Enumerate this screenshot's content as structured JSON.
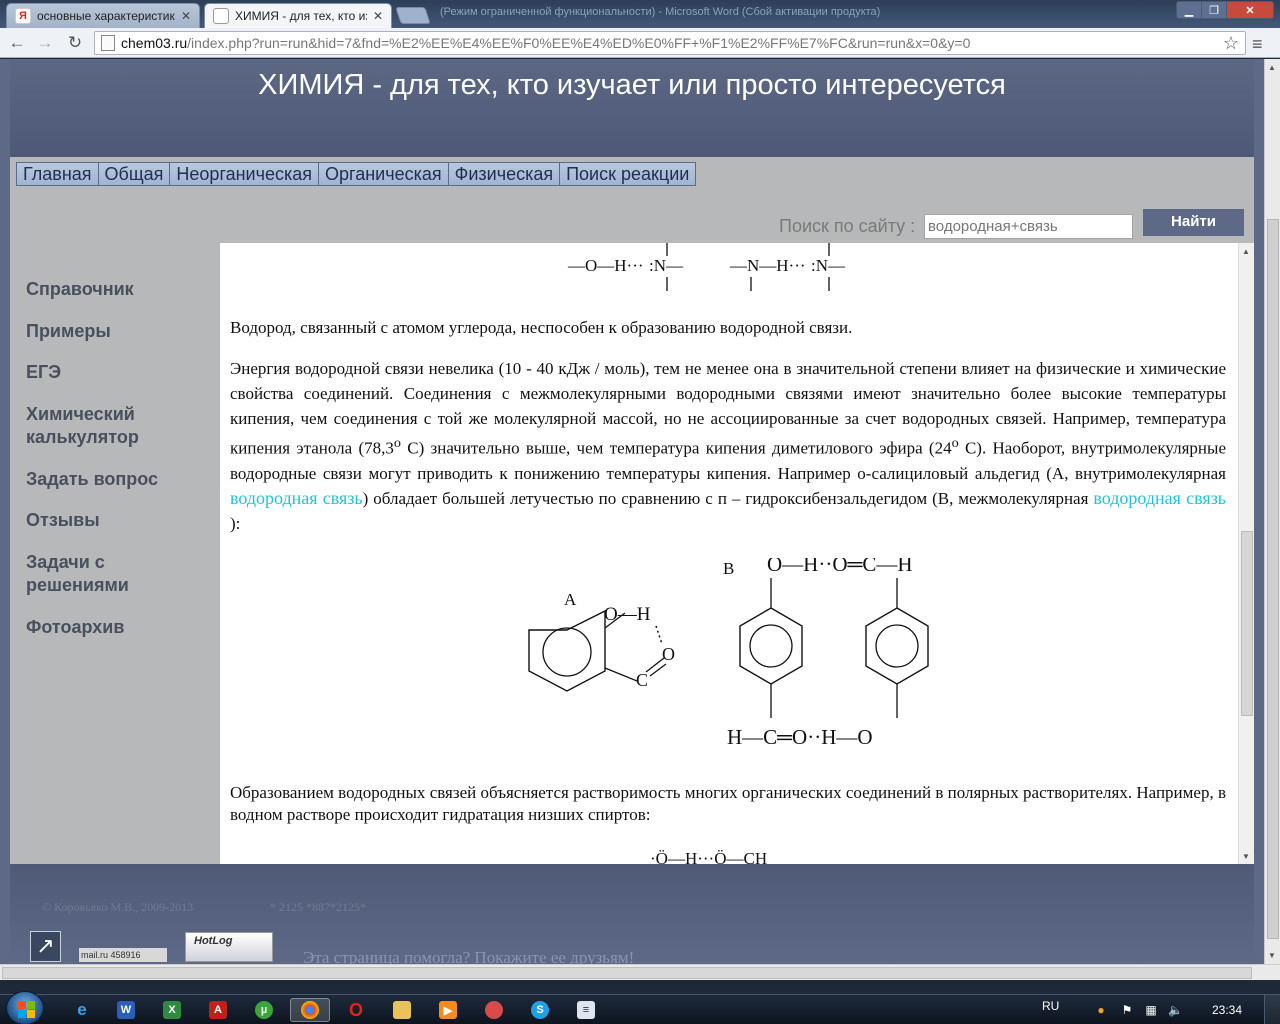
{
  "browser": {
    "tabs": [
      {
        "title": "основные характеристики",
        "favicon": "yandex-icon",
        "active": false
      },
      {
        "title": "ХИМИЯ - для тех, кто изу",
        "favicon": "page-icon",
        "active": true
      }
    ],
    "background_window_title": "(Режим ограниченной функциональности) - Microsoft Word (Сбой активации продукта)",
    "url_host": "chem03.ru",
    "url_rest": "/index.php?run=run&hid=7&fnd=%E2%EE%E4%EE%F0%EE%E4%ED%E0%FF+%F1%E2%FF%E7%FC&run=run&x=0&y=0"
  },
  "site": {
    "title": "ХИМИЯ - для тех, кто изучает или просто интересуется",
    "nav": [
      "Главная",
      "Общая",
      "Неорганическая",
      "Органическая",
      "Физическая",
      "Поиск реакции"
    ],
    "search": {
      "label": "Поиск по сайту :",
      "value": "водородная+связь",
      "button": "Найти"
    },
    "sidebar": [
      "Справочник",
      "Примеры",
      "ЕГЭ",
      "Химический\nкалькулятор",
      "Задать вопрос",
      "Отзывы",
      "Задачи с\nрешениями",
      "Фотоархив"
    ]
  },
  "content": {
    "para1": "Водород, связанный с атомом углерода, неспособен к образованию водородной связи.",
    "para2_a": "Энергия водородной связи невелика (10 - 40 кДж / моль), тем не менее она в значительной степени влияет на физические и химические свойства соединений. Соединения с межмолекулярными водородными связями имеют значительно более высокие температуры кипения, чем соединения с той же молекулярной массой, но не ассоциированные за счет водородных связей. Например, температура кипения этанола (78,3",
    "para2_sup1": "o",
    "para2_b": " С) значительно выше, чем температура кипения диметилового эфира (24",
    "para2_sup2": "o",
    "para2_c": " С). Наоборот, внутримолекулярные водородные связи могут приводить к понижению температуры кипения. Например о-салициловый альдегид (А, внутримолекулярная ",
    "para2_kw1": "водородная связь",
    "para2_d": ") обладает большей летучестью по сравнению с п – гидроксибензальдегидом (В, межмолекулярная ",
    "para2_kw2": "водородная связь",
    "para2_e": " ):",
    "para3": "Образованием водородных связей объясняется растворимость многих органических соединений в полярных растворителях. Например, в водном растворе происходит гидратация низших спиртов:",
    "top_formula": {
      "left": [
        "—O—H···",
        ":N—"
      ],
      "right": [
        "—N—H···",
        ":N—"
      ]
    },
    "figure": {
      "label_a": "A",
      "label_b": "B",
      "a_oh": "O—H",
      "a_o": "O",
      "a_c": "C",
      "b_top": "O—H··O═C—H",
      "b_bottom": "H—C═O··H—O"
    },
    "bottom_formula": "·Ö—H···Ö—CH"
  },
  "footer": {
    "copyright": "© Коровьяко М.В., 2009-2013",
    "phone": "* 2125 *887*2125*",
    "counter": "mail.ru 458916",
    "hotlog": "HotLog",
    "share": "Эта страница помогла? Покажите ее друзьям!"
  },
  "taskbar": {
    "lang": "RU",
    "clock": "23:34"
  }
}
